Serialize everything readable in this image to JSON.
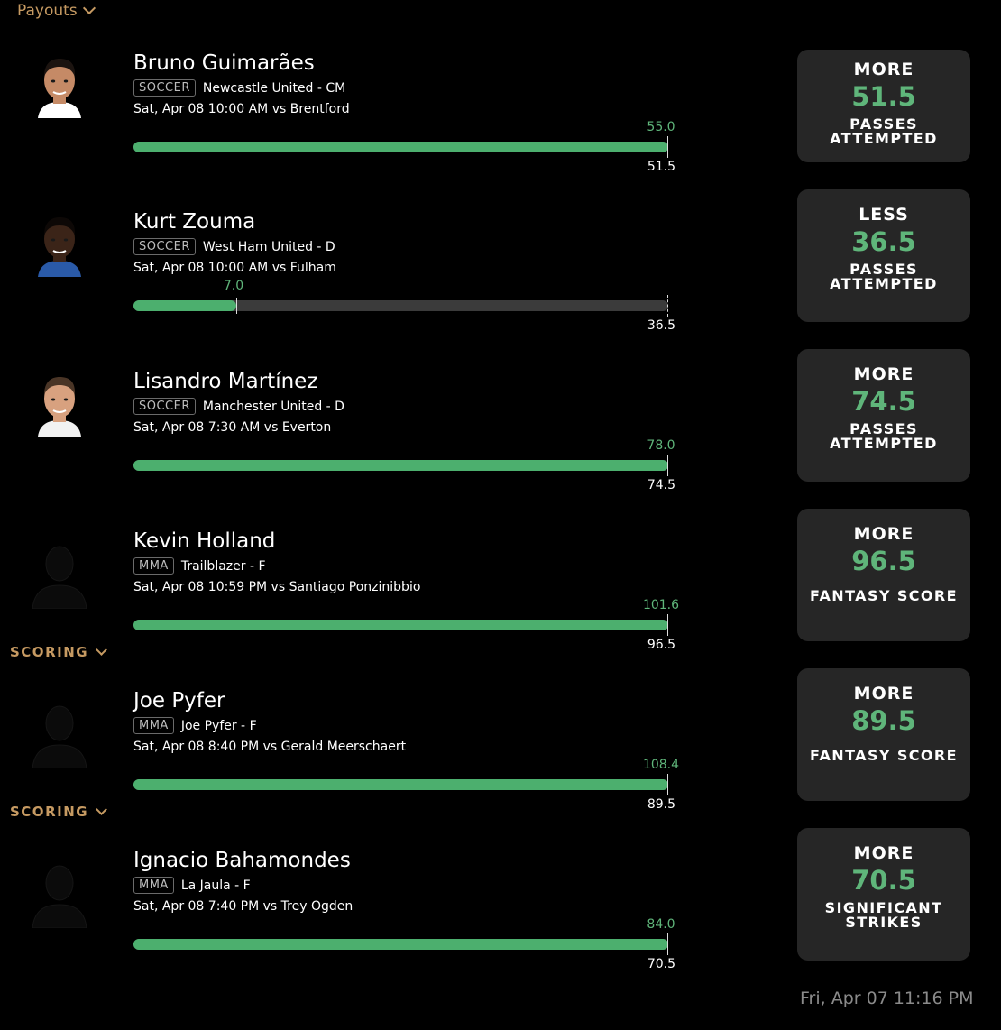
{
  "header": {
    "payouts_label": "Payouts"
  },
  "colors": {
    "accent": "#c69a62",
    "hit_green": "#4caf6e",
    "value_green": "#5fb57a",
    "card_bg": "#262626",
    "track": "#3b3b3b"
  },
  "picks": [
    {
      "player": "Bruno Guimarães",
      "sport": "SOCCER",
      "team_pos": "Newcastle United - CM",
      "game": "Sat, Apr 08 10:00 AM  vs Brentford",
      "actual": "55.0",
      "line_label": "51.5",
      "progress": 1.0,
      "direction": "MORE",
      "line": "51.5",
      "stat": [
        "PASSES",
        "ATTEMPTED"
      ],
      "avatar": "photo",
      "scoring_label": ""
    },
    {
      "player": "Kurt Zouma",
      "sport": "SOCCER",
      "team_pos": "West Ham United - D",
      "game": "Sat, Apr 08 10:00 AM  vs Fulham",
      "actual": "7.0",
      "line_label": "36.5",
      "progress": 0.192,
      "direction": "LESS",
      "line": "36.5",
      "stat": [
        "PASSES",
        "ATTEMPTED"
      ],
      "avatar": "photo",
      "scoring_label": ""
    },
    {
      "player": "Lisandro Martínez",
      "sport": "SOCCER",
      "team_pos": "Manchester United - D",
      "game": "Sat, Apr 08 7:30 AM  vs Everton",
      "actual": "78.0",
      "line_label": "74.5",
      "progress": 1.0,
      "direction": "MORE",
      "line": "74.5",
      "stat": [
        "PASSES",
        "ATTEMPTED"
      ],
      "avatar": "photo",
      "scoring_label": ""
    },
    {
      "player": "Kevin Holland",
      "sport": "MMA",
      "team_pos": "Trailblazer - F",
      "game": "Sat, Apr 08 10:59 PM  vs Santiago Ponzinibbio",
      "actual": "101.6",
      "line_label": "96.5",
      "progress": 1.0,
      "direction": "MORE",
      "line": "96.5",
      "stat": [
        "FANTASY SCORE"
      ],
      "avatar": "silhouette",
      "scoring_label": "SCORING"
    },
    {
      "player": "Joe Pyfer",
      "sport": "MMA",
      "team_pos": "Joe Pyfer - F",
      "game": "Sat, Apr 08 8:40 PM  vs Gerald Meerschaert",
      "actual": "108.4",
      "line_label": "89.5",
      "progress": 1.0,
      "direction": "MORE",
      "line": "89.5",
      "stat": [
        "FANTASY SCORE"
      ],
      "avatar": "silhouette",
      "scoring_label": "SCORING"
    },
    {
      "player": "Ignacio Bahamondes",
      "sport": "MMA",
      "team_pos": "La Jaula - F",
      "game": "Sat, Apr 08 7:40 PM  vs Trey Ogden",
      "actual": "84.0",
      "line_label": "70.5",
      "progress": 1.0,
      "direction": "MORE",
      "line": "70.5",
      "stat": [
        "SIGNIFICANT",
        "STRIKES"
      ],
      "avatar": "silhouette",
      "scoring_label": ""
    }
  ],
  "footer": {
    "timestamp": "Fri, Apr 07 11:16 PM"
  }
}
